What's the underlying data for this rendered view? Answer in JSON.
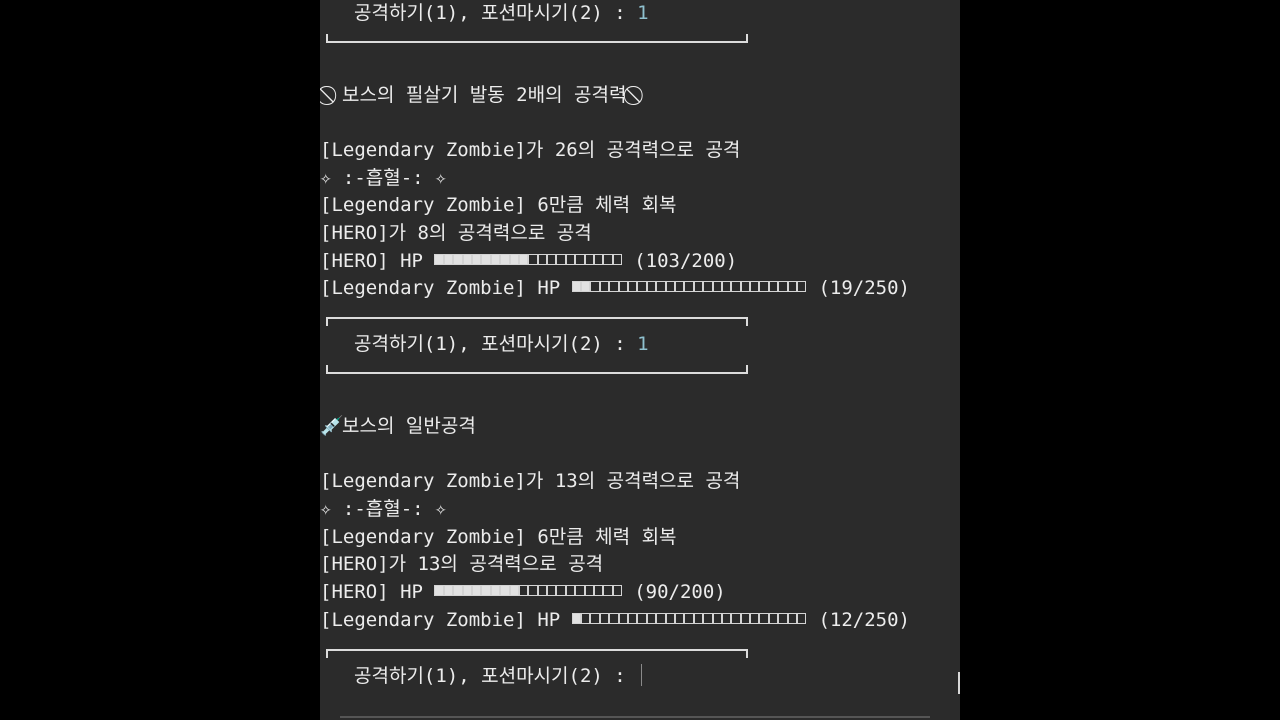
{
  "terminal": {
    "lines": {
      "prompt_1": {
        "label": "공격하기(1), 포션마시기(2) : ",
        "input": "1"
      },
      "boss_skill": {
        "icon": "prohibited-icon",
        "text": "보스의 필살기 발동 2배의 공격력"
      },
      "zombie_attack_1": "[Legendary Zombie]가 26의 공격력으로 공격",
      "drain_1": "✧ :-흡혈-: ✧",
      "heal_1": "[Legendary Zombie] 6만큼 체력 회복",
      "hero_attack_1": "[HERO]가 8의 공격력으로 공격",
      "hero_hp_1": {
        "label": "[HERO] HP ",
        "filled": 10,
        "total": 20,
        "value": "(103/200)"
      },
      "zombie_hp_1": {
        "label": "[Legendary Zombie] HP ",
        "filled": 2,
        "total": 25,
        "value": "(19/250)"
      },
      "prompt_2": {
        "label": "공격하기(1), 포션마시기(2) : ",
        "input": "1"
      },
      "boss_normal": {
        "icon": "syringe-icon",
        "text": "보스의 일반공격"
      },
      "zombie_attack_2": "[Legendary Zombie]가 13의 공격력으로 공격",
      "drain_2": "✧ :-흡혈-: ✧",
      "heal_2": "[Legendary Zombie] 6만큼 체력 회복",
      "hero_attack_2": "[HERO]가 13의 공격력으로 공격",
      "hero_hp_2": {
        "label": "[HERO] HP ",
        "filled": 9,
        "total": 20,
        "value": "(90/200)"
      },
      "zombie_hp_2": {
        "label": "[Legendary Zombie] HP ",
        "filled": 1,
        "total": 25,
        "value": "(12/250)"
      },
      "prompt_3": {
        "label": "공격하기(1), 포션마시기(2) : ",
        "input": ""
      }
    }
  }
}
